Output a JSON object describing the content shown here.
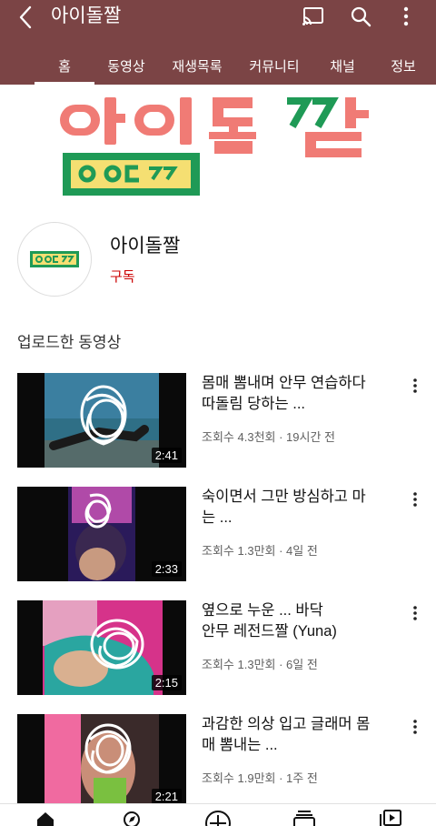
{
  "header": {
    "title": "아이돌짤",
    "back_icon": "back-arrow-icon",
    "actions": [
      "cast-icon",
      "search-icon",
      "more-vert-icon"
    ],
    "color": "#7b4445"
  },
  "tabs": [
    {
      "label": "홈",
      "active": true
    },
    {
      "label": "동영상"
    },
    {
      "label": "재생목록"
    },
    {
      "label": "커뮤니티"
    },
    {
      "label": "채널"
    },
    {
      "label": "정보"
    }
  ],
  "banner": {
    "title_text": "아이돌짤",
    "logo_text": "ㅇㅇㄷㅉㅉ",
    "colors": {
      "pink": "#f07b75",
      "green": "#1f9a56",
      "yellow": "#f5df72"
    }
  },
  "channel": {
    "name": "아이돌짤",
    "subscribe_label": "구독"
  },
  "uploads": {
    "title": "업로드한 동영상",
    "videos": [
      {
        "title_line1": "몸매 뽐내며 안무 연습하다",
        "title_line2": "따돌림 당하는 ...",
        "meta": "조회수 4.3천회 · 19시간 전",
        "duration": "2:41"
      },
      {
        "title_line1": "숙이면서 그만 방심하고 마",
        "title_line2": "는 ...",
        "meta": "조회수 1.3만회 · 4일 전",
        "duration": "2:33"
      },
      {
        "title_line1": "옆으로 누운 ... 바닥",
        "title_line2": "안무 레전드짤 (Yuna)",
        "meta": "조회수 1.3만회 · 6일 전",
        "duration": "2:15"
      },
      {
        "title_line1": "과감한 의상 입고 글래머 몸",
        "title_line2": "매 뽐내는 ...",
        "meta": "조회수 1.9만회 · 1주 전",
        "duration": "2:21"
      }
    ]
  },
  "bottom_nav": [
    "home-icon",
    "explore-icon",
    "add-icon",
    "subscriptions-icon",
    "library-icon"
  ]
}
